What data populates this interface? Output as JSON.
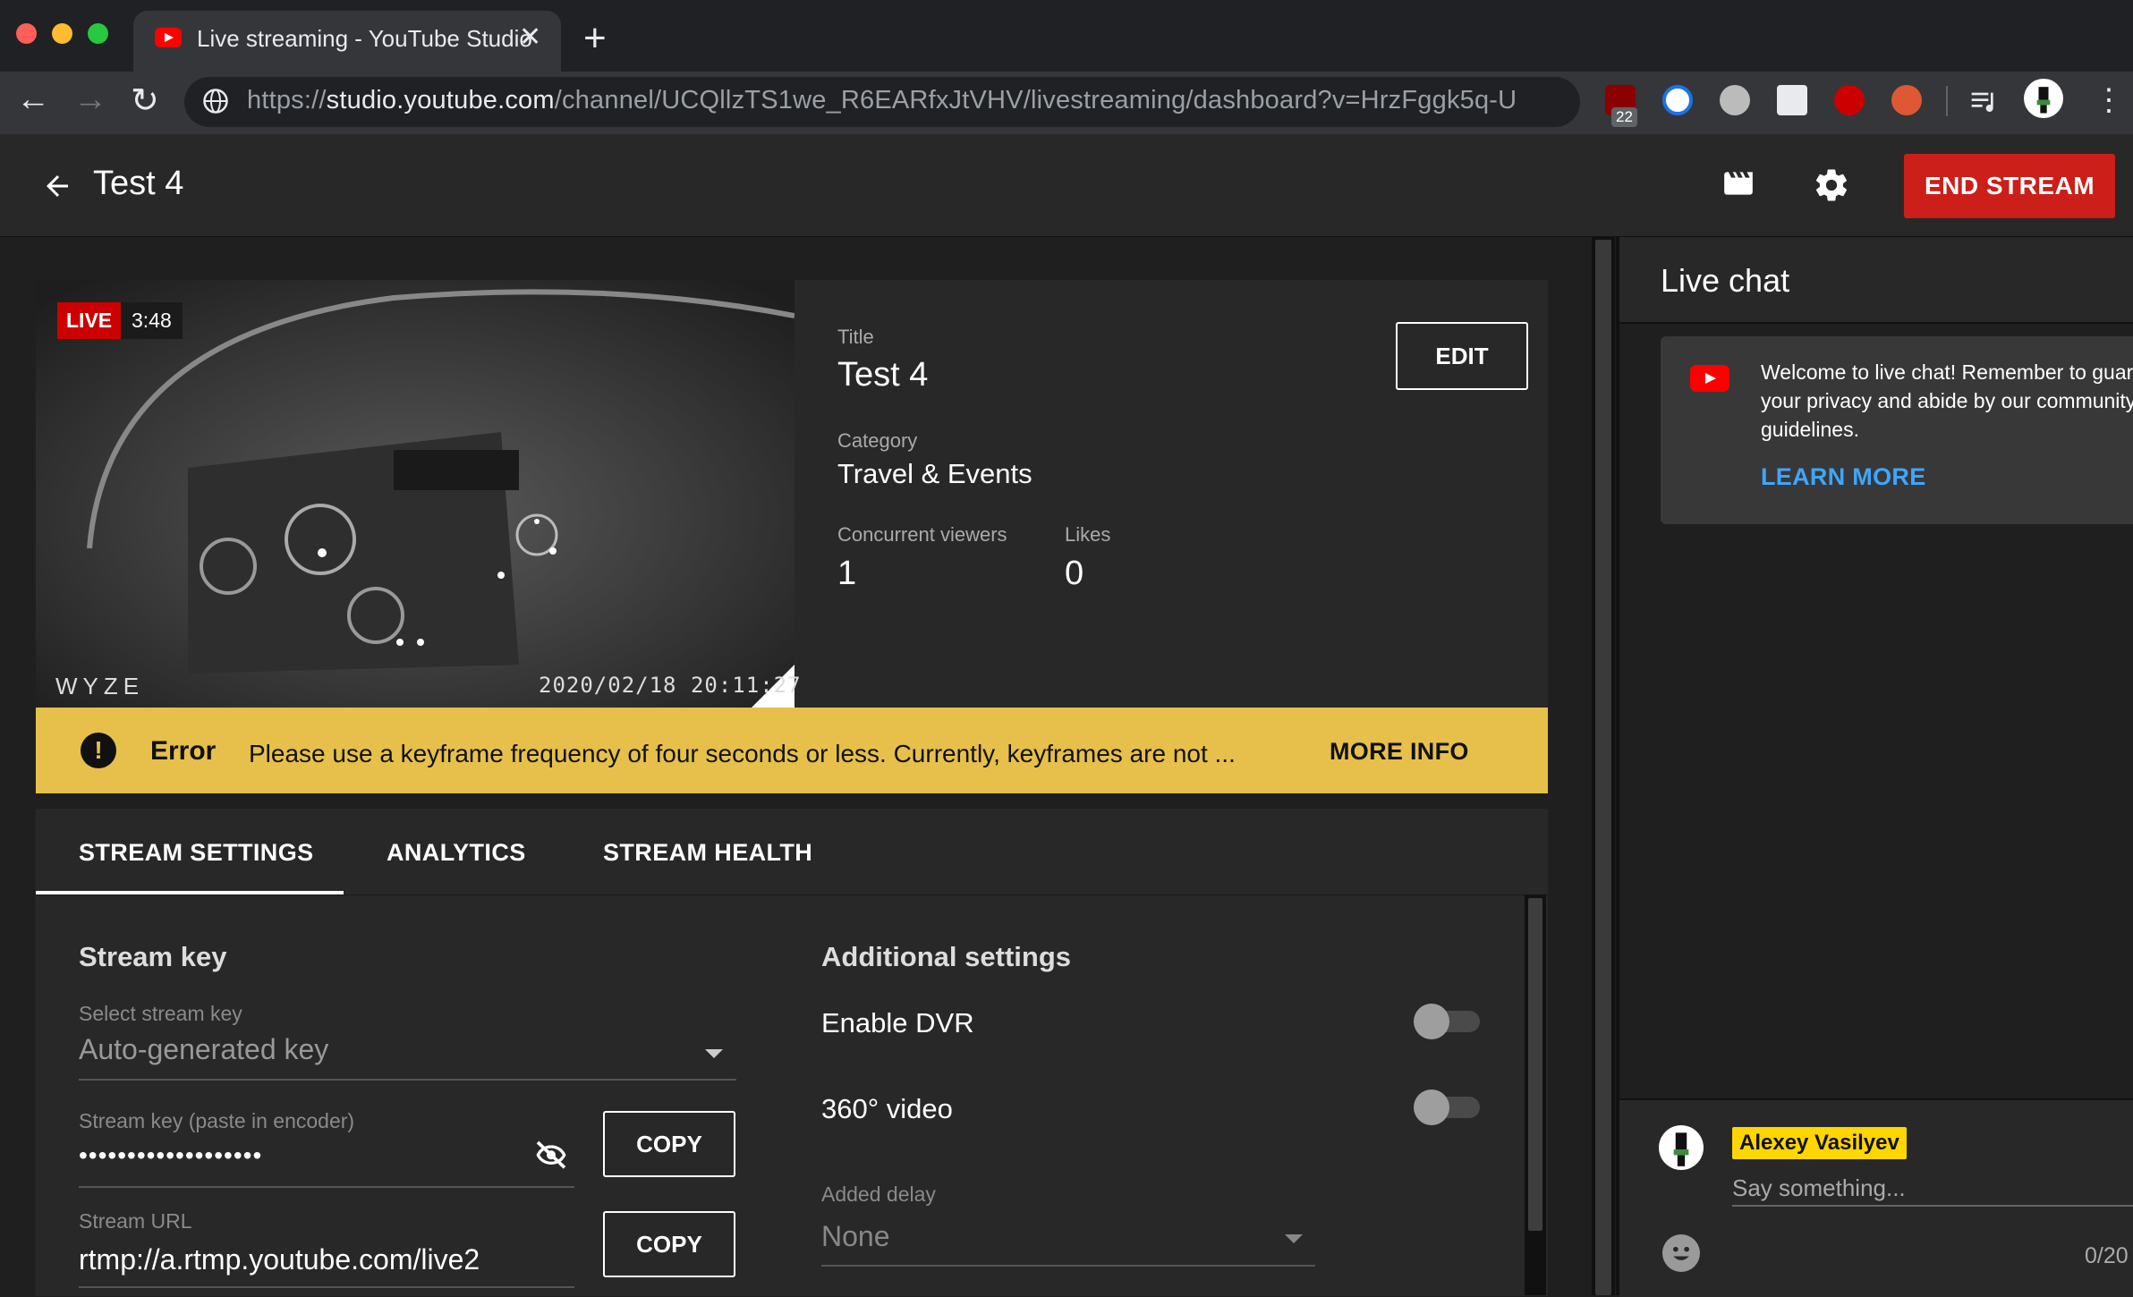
{
  "browser": {
    "tab_title": "Live streaming - YouTube Studio",
    "tab_close": "✕",
    "new_tab": "+",
    "url_prefix": "https://",
    "url_host": "studio.youtube.com",
    "url_path": "/channel/UCQllzTS1we_R6EARfxJtVHV/livestreaming/dashboard?v=HrzFggk5q-U",
    "extension_badge": "22",
    "nav": {
      "back": "←",
      "forward": "→",
      "reload": "↻",
      "menu": "⋮"
    }
  },
  "header": {
    "title": "Test 4",
    "end_stream_label": "END STREAM"
  },
  "preview": {
    "live_label": "LIVE",
    "elapsed": "3:48",
    "camera_logo": "WYZE",
    "camera_timestamp": "2020/02/18 20:11:27"
  },
  "details": {
    "title_label": "Title",
    "title_value": "Test 4",
    "category_label": "Category",
    "category_value": "Travel & Events",
    "viewers_label": "Concurrent viewers",
    "viewers_value": "1",
    "likes_label": "Likes",
    "likes_value": "0",
    "edit_label": "EDIT"
  },
  "error": {
    "icon": "!",
    "title": "Error",
    "message": "Please use a keyframe frequency of four seconds or less. Currently, keyframes are not ...",
    "more_info": "MORE INFO"
  },
  "tabs": [
    {
      "label": "STREAM SETTINGS",
      "active": true
    },
    {
      "label": "ANALYTICS",
      "active": false
    },
    {
      "label": "STREAM HEALTH",
      "active": false
    }
  ],
  "stream_key": {
    "section_title": "Stream key",
    "select_label": "Select stream key",
    "select_value": "Auto-generated key",
    "key_label": "Stream key (paste in encoder)",
    "key_value": "•••••••••••••••••••",
    "copy_label": "COPY",
    "url_label": "Stream URL",
    "url_value": "rtmp://a.rtmp.youtube.com/live2",
    "copy_url_label": "COPY"
  },
  "additional": {
    "section_title": "Additional settings",
    "dvr_label": "Enable DVR",
    "dvr_enabled": false,
    "video360_label": "360° video",
    "video360_enabled": false,
    "delay_label": "Added delay",
    "delay_value": "None"
  },
  "chat": {
    "title": "Live chat",
    "welcome_text": "Welcome to live chat! Remember to guard your privacy and abide by our community guidelines.",
    "learn_more": "LEARN MORE",
    "username": "Alexey Vasilyev",
    "placeholder": "Say something...",
    "char_count": "0/20"
  },
  "colors": {
    "end_stream": "#cc1f1a",
    "error_bar": "#e6c04a",
    "link": "#3ea6ff",
    "username_badge": "#ffd600"
  }
}
